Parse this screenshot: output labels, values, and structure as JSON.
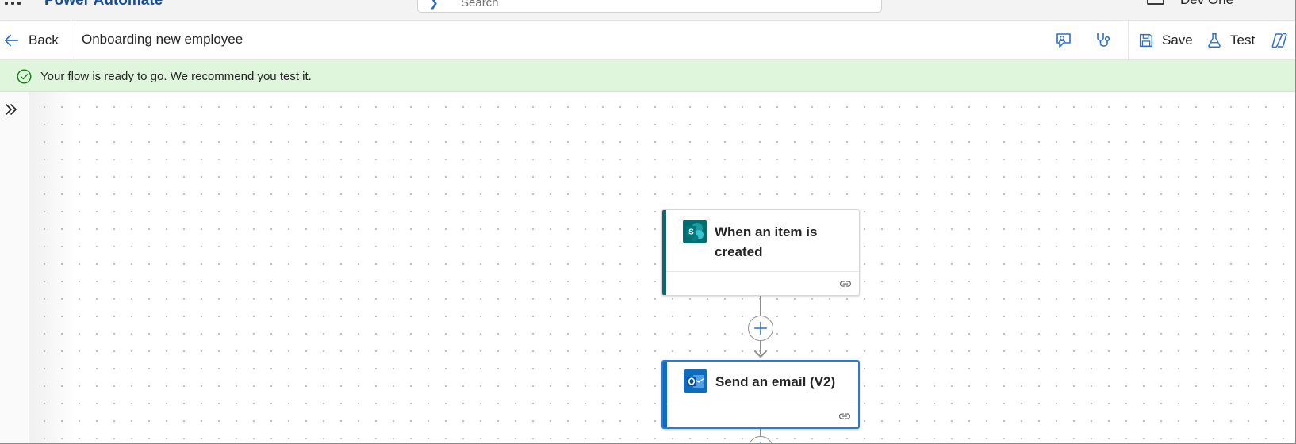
{
  "suite_bar": {
    "app_name": "Power Automate",
    "search_placeholder": "Search",
    "user_name": "Dev One"
  },
  "command_bar": {
    "back_label": "Back",
    "flow_title": "Onboarding new employee",
    "save_label": "Save",
    "test_label": "Test",
    "icons": [
      "feedback-icon",
      "flow-checker-icon",
      "save-icon",
      "test-flask-icon",
      "copilot-icon"
    ]
  },
  "banner": {
    "message": "Your flow is ready to go. We recommend you test it."
  },
  "canvas": {
    "nodes": [
      {
        "title": "When an item is created",
        "icon": "sharepoint-icon",
        "accent": "#036c70",
        "selected": false
      },
      {
        "title": "Send an email (V2)",
        "icon": "outlook-icon",
        "accent": "#0f6cbd",
        "selected": true
      }
    ]
  },
  "colors": {
    "banner_bg": "#dff6dd",
    "success_green": "#107c10",
    "accent_blue": "#0f6cbd",
    "sharepoint_teal": "#036c70"
  }
}
